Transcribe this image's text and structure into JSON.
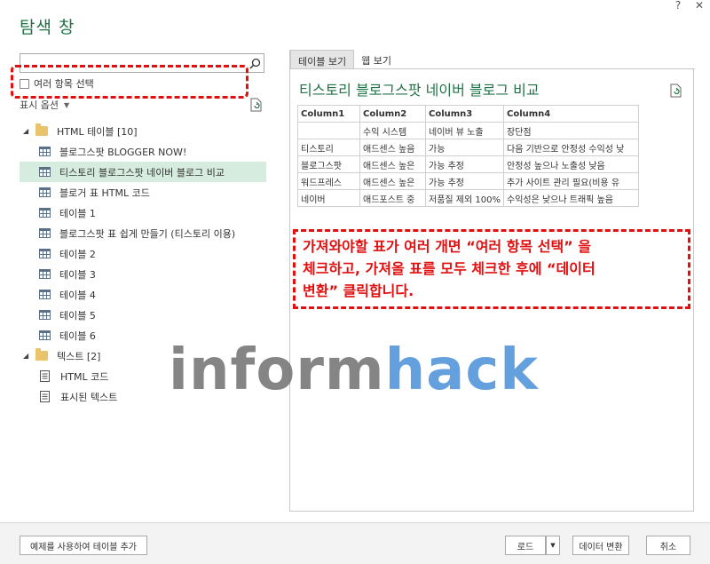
{
  "window": {
    "help_icon": "?",
    "close_icon": "✕"
  },
  "title": "탐색 창",
  "search": {
    "value": "",
    "placeholder": ""
  },
  "multi_select_label": "여러 항목 선택",
  "display_options_label": "표시 옵션",
  "tree": {
    "folder1": {
      "label": "HTML 테이블 [10]"
    },
    "items1": [
      "블로그스팟 BLOGGER NOW!",
      "티스토리 블로그스팟 네이버 블로그 비교",
      "블로거 표 HTML 코드",
      "테이블 1",
      "블로그스팟 표 쉽게 만들기 (티스토리 이용)",
      "테이블 2",
      "테이블 3",
      "테이블 4",
      "테이블 5",
      "테이블 6"
    ],
    "folder2": {
      "label": "텍스트 [2]"
    },
    "items2": [
      "HTML 코드",
      "표시된 텍스트"
    ]
  },
  "tabs": [
    "테이블 보기",
    "웹 보기"
  ],
  "preview_title": "티스토리 블로그스팟 네이버 블로그 비교",
  "preview_table": {
    "headers": [
      "Column1",
      "Column2",
      "Column3",
      "Column4"
    ],
    "rows": [
      [
        "",
        "수익 시스템",
        "네이버 뷰 노출",
        "장단점"
      ],
      [
        "티스토리",
        "애드센스 높음",
        "가능",
        "다음 기반으로 안정성 수익성 낮"
      ],
      [
        "블로그스팟",
        "애드센스 높은",
        "가능 추정",
        "안정성 높으나 노출성 낮음"
      ],
      [
        "워드프레스",
        "애드센스 높은",
        "가능 추정",
        "추가 사이트 관리 필요(비용 유"
      ],
      [
        "네이버",
        "애드포스트 중",
        "저품질 제외 100%",
        "수익성은 낮으나 트래픽 높음"
      ]
    ]
  },
  "callout": {
    "line1": "가져와야할 표가 여러 개면 “여러 항목 선택” 을",
    "line2": "체크하고, 가져올 표를 모두 체크한 후에 “데이터",
    "line3": "변환” 클릭합니다."
  },
  "watermark": {
    "part1": "inform",
    "part2": "hack"
  },
  "buttons": {
    "example": "예제를 사용하여 테이블 추가",
    "load": "로드",
    "transform": "데이터 변환",
    "cancel": "취소"
  },
  "colors": {
    "accent": "#217346",
    "highlight": "#e01010",
    "selected_row": "#d6ecde"
  }
}
